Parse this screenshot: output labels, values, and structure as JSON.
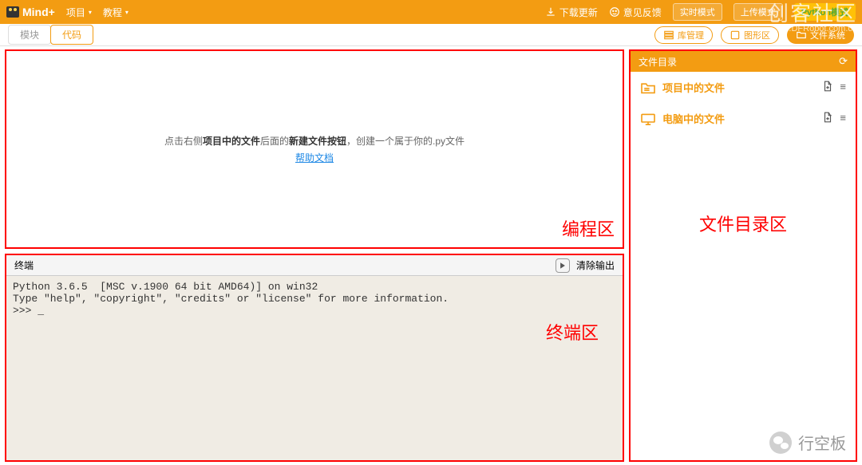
{
  "header": {
    "logo": "Mind+",
    "menu_project": "项目",
    "menu_tutorial": "教程",
    "download_update": "下载更新",
    "feedback": "意见反馈",
    "mode_realtime": "实时模式",
    "mode_upload": "上传模式",
    "mode_python": "Python模式"
  },
  "toolbar": {
    "tab_block": "模块",
    "tab_code": "代码",
    "lib_manage": "库管理",
    "graphic_area": "图形区",
    "file_system": "文件系统"
  },
  "editor": {
    "hint_pre": "点击右侧",
    "hint_bold1": "项目中的文件",
    "hint_mid": "后面的",
    "hint_bold2": "新建文件按钮",
    "hint_post": "，创建一个属于你的.py文件",
    "help_link": "帮助文档",
    "area_label": "编程区"
  },
  "terminal": {
    "title": "终端",
    "clear": "清除输出",
    "area_label": "终端区",
    "line1": "Python 3.6.5  [MSC v.1900 64 bit AMD64)] on win32",
    "line2": "Type \"help\", \"copyright\", \"credits\" or \"license\" for more information.",
    "line3": ">>> _"
  },
  "files": {
    "panel_title": "文件目录",
    "row_project": "项目中的文件",
    "row_computer": "电脑中的文件",
    "area_label": "文件目录区"
  },
  "watermark": {
    "top_title": "创客社区",
    "top_url": "mc.DFRobot.com.cn",
    "bottom": "行空板"
  }
}
